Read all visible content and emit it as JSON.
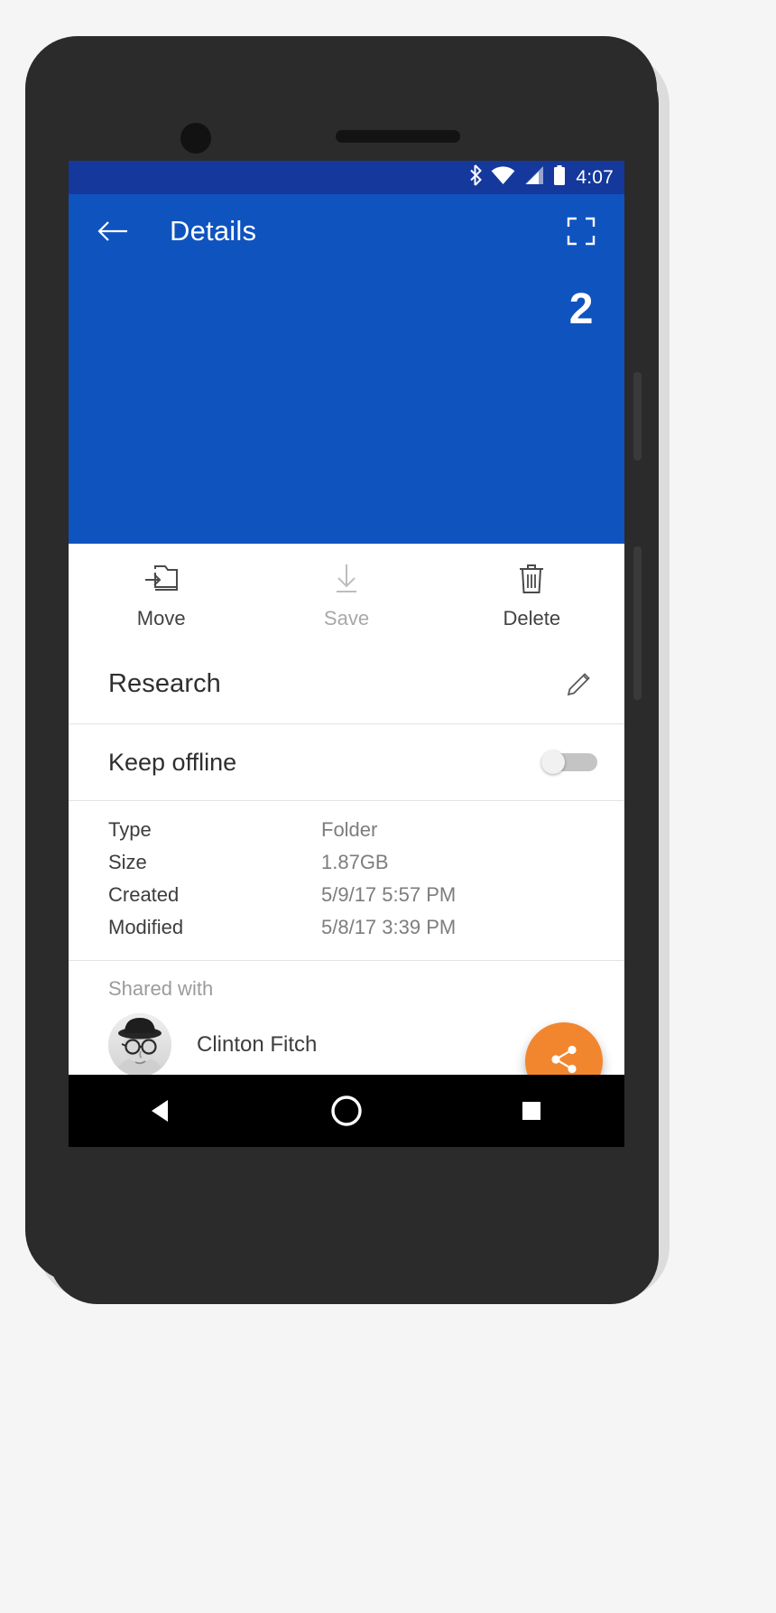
{
  "status_bar": {
    "time": "4:07",
    "icons": [
      "bluetooth-icon",
      "wifi-icon",
      "cellular-signal-icon",
      "battery-icon"
    ]
  },
  "app_bar": {
    "title": "Details",
    "back_icon": "arrow-left-icon",
    "fullscreen_icon": "fullscreen-icon"
  },
  "preview": {
    "item_count": "2"
  },
  "actions": [
    {
      "label": "Move",
      "icon": "move-to-folder-icon",
      "disabled": false
    },
    {
      "label": "Save",
      "icon": "download-arrow-icon",
      "disabled": true
    },
    {
      "label": "Delete",
      "icon": "trash-icon",
      "disabled": false
    }
  ],
  "item": {
    "title": "Research",
    "edit_icon": "pencil-icon"
  },
  "offline": {
    "label": "Keep offline",
    "enabled": false
  },
  "metadata": {
    "rows": [
      {
        "key": "Type",
        "value": "Folder"
      },
      {
        "key": "Size",
        "value": "1.87GB"
      },
      {
        "key": "Created",
        "value": "5/9/17 5:57 PM"
      },
      {
        "key": "Modified",
        "value": "5/8/17 3:39 PM"
      }
    ]
  },
  "shared": {
    "label": "Shared with",
    "people": [
      {
        "name": "Clinton Fitch"
      }
    ]
  },
  "fab": {
    "icon": "share-icon",
    "color": "#F2862F"
  },
  "nav_bar": {
    "back": "back-triangle-icon",
    "home": "home-circle-icon",
    "recents": "recents-square-icon"
  },
  "colors": {
    "app_bar": "#0F53BF",
    "status_bar": "#14389C",
    "accent": "#F2862F"
  }
}
